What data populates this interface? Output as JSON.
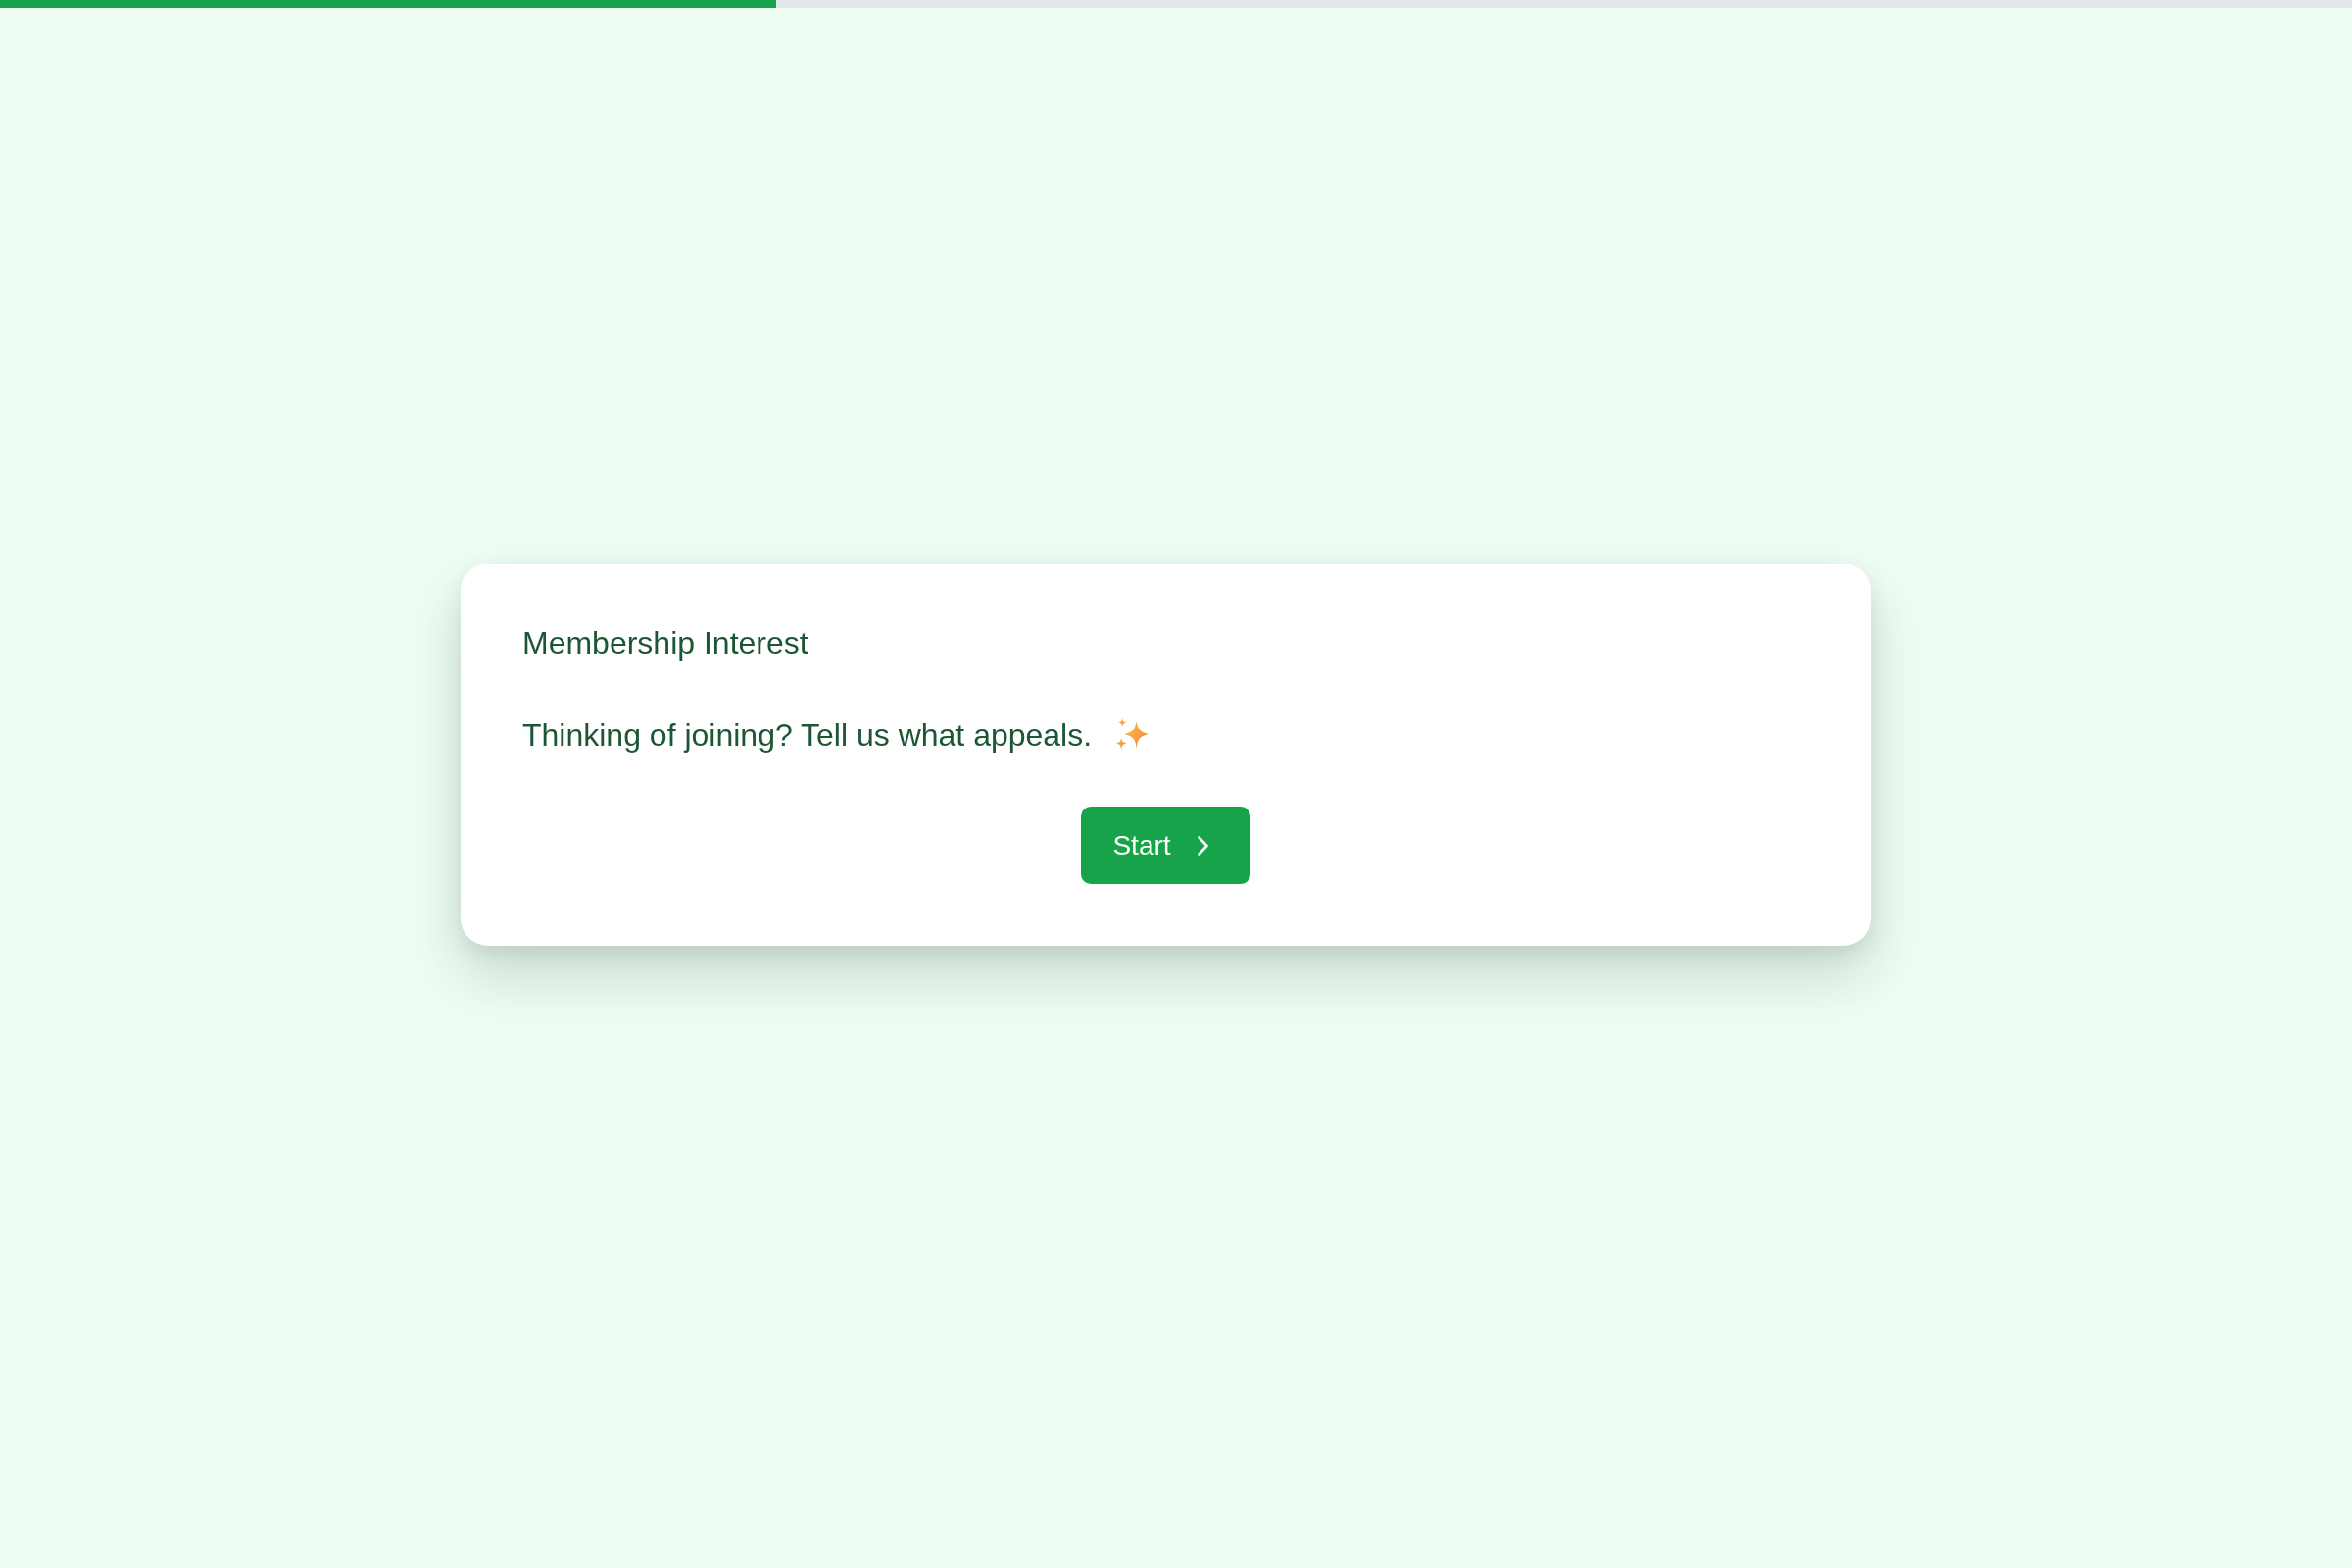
{
  "progress": {
    "level": 0.33
  },
  "card": {
    "title": "Membership Interest",
    "message": "Thinking of joining? Tell us what appeals.",
    "button": {
      "label": "Start"
    }
  }
}
